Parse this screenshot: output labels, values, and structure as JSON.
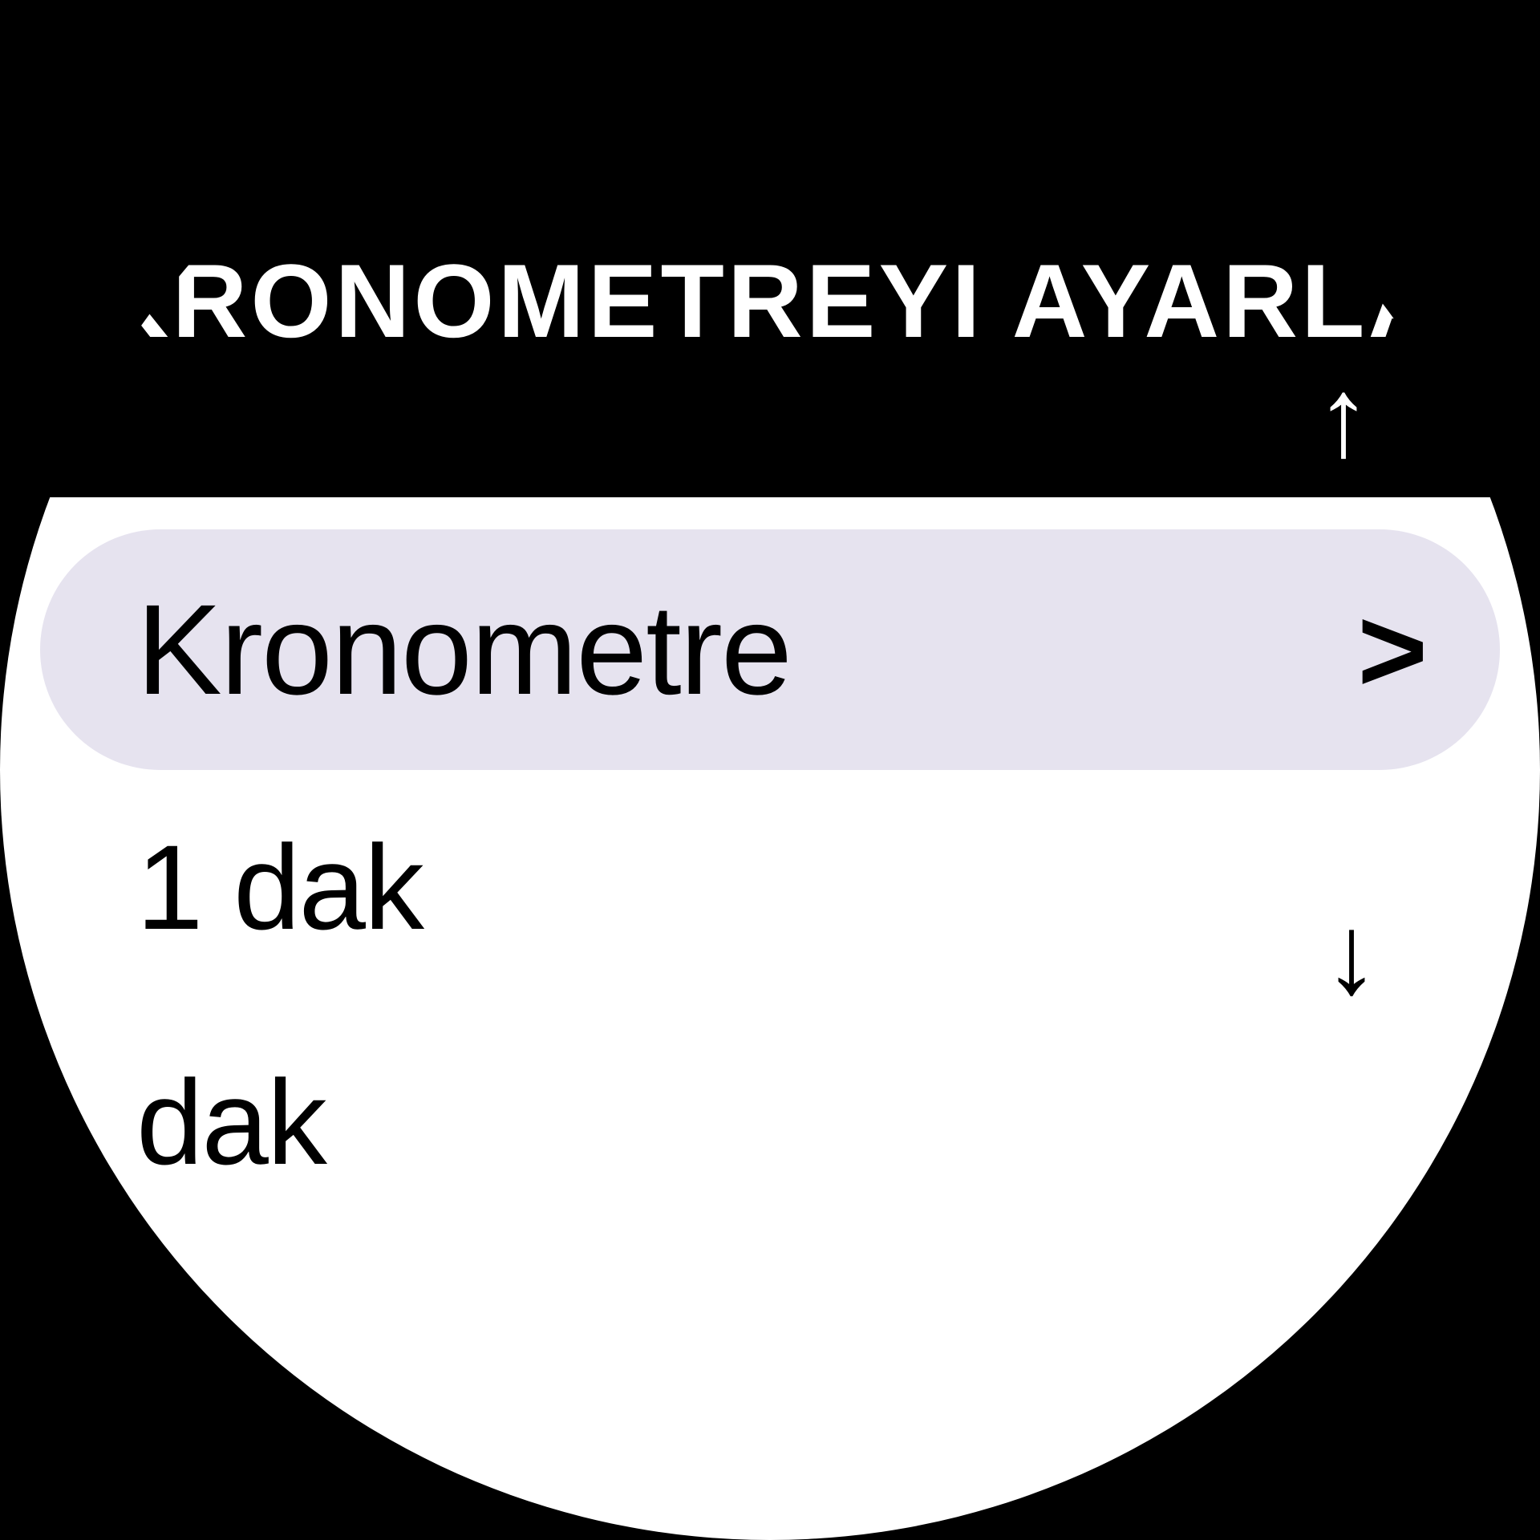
{
  "header": {
    "title": "KRONOMETREYI AYARLA"
  },
  "icons": {
    "scroll_up": "↑",
    "scroll_down": "↓",
    "chevron_right": ">"
  },
  "menu": {
    "selected_label": "Kronometre",
    "item1_label": "1 dak",
    "item2_label": "dak"
  }
}
